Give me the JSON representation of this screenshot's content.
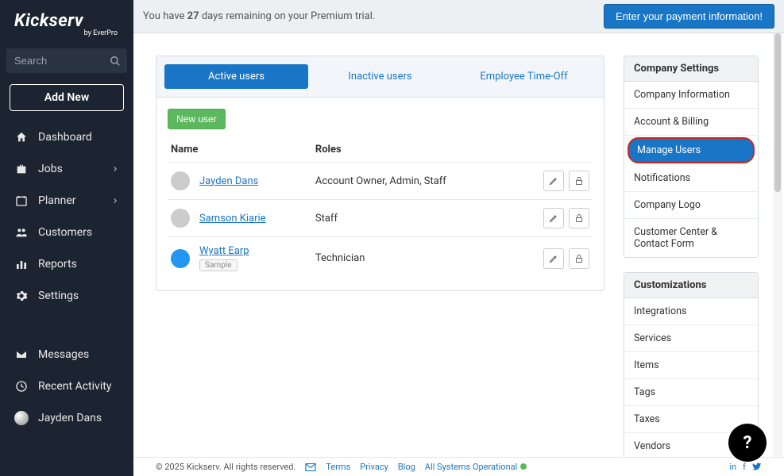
{
  "brand": {
    "name": "Kickserv",
    "byline": "by EverPro"
  },
  "search": {
    "placeholder": "Search"
  },
  "add_new_label": "Add New",
  "nav": {
    "dashboard": "Dashboard",
    "jobs": "Jobs",
    "planner": "Planner",
    "customers": "Customers",
    "reports": "Reports",
    "settings": "Settings",
    "messages": "Messages",
    "recent": "Recent Activity"
  },
  "current_user": {
    "name": "Jayden Dans"
  },
  "trial": {
    "prefix": "You have ",
    "days": "27",
    "suffix": " days remaining on your Premium trial."
  },
  "cta_label": "Enter your payment information!",
  "tabs": {
    "active": "Active users",
    "inactive": "Inactive users",
    "timeoff": "Employee Time-Off"
  },
  "new_user_label": "New user",
  "table": {
    "col_name": "Name",
    "col_roles": "Roles",
    "rows": [
      {
        "name": "Jayden Dans",
        "roles": "Account Owner, Admin, Staff",
        "sample": false
      },
      {
        "name": "Samson Kiarie",
        "roles": "Staff",
        "sample": false
      },
      {
        "name": "Wyatt Earp",
        "roles": "Technician",
        "sample": true
      }
    ],
    "sample_label": "Sample"
  },
  "settings_panel": {
    "title": "Company Settings",
    "items": [
      "Company Information",
      "Account & Billing",
      "Manage Users",
      "Notifications",
      "Company Logo",
      "Customer Center & Contact Form"
    ],
    "active_index": 2
  },
  "custom_panel": {
    "title": "Customizations",
    "items": [
      "Integrations",
      "Services",
      "Items",
      "Tags",
      "Taxes",
      "Vendors"
    ]
  },
  "footer": {
    "copyright": "© 2025 Kickserv. All rights reserved.",
    "terms": "Terms",
    "privacy": "Privacy",
    "blog": "Blog",
    "status": "All Systems Operational"
  },
  "help_label": "?"
}
